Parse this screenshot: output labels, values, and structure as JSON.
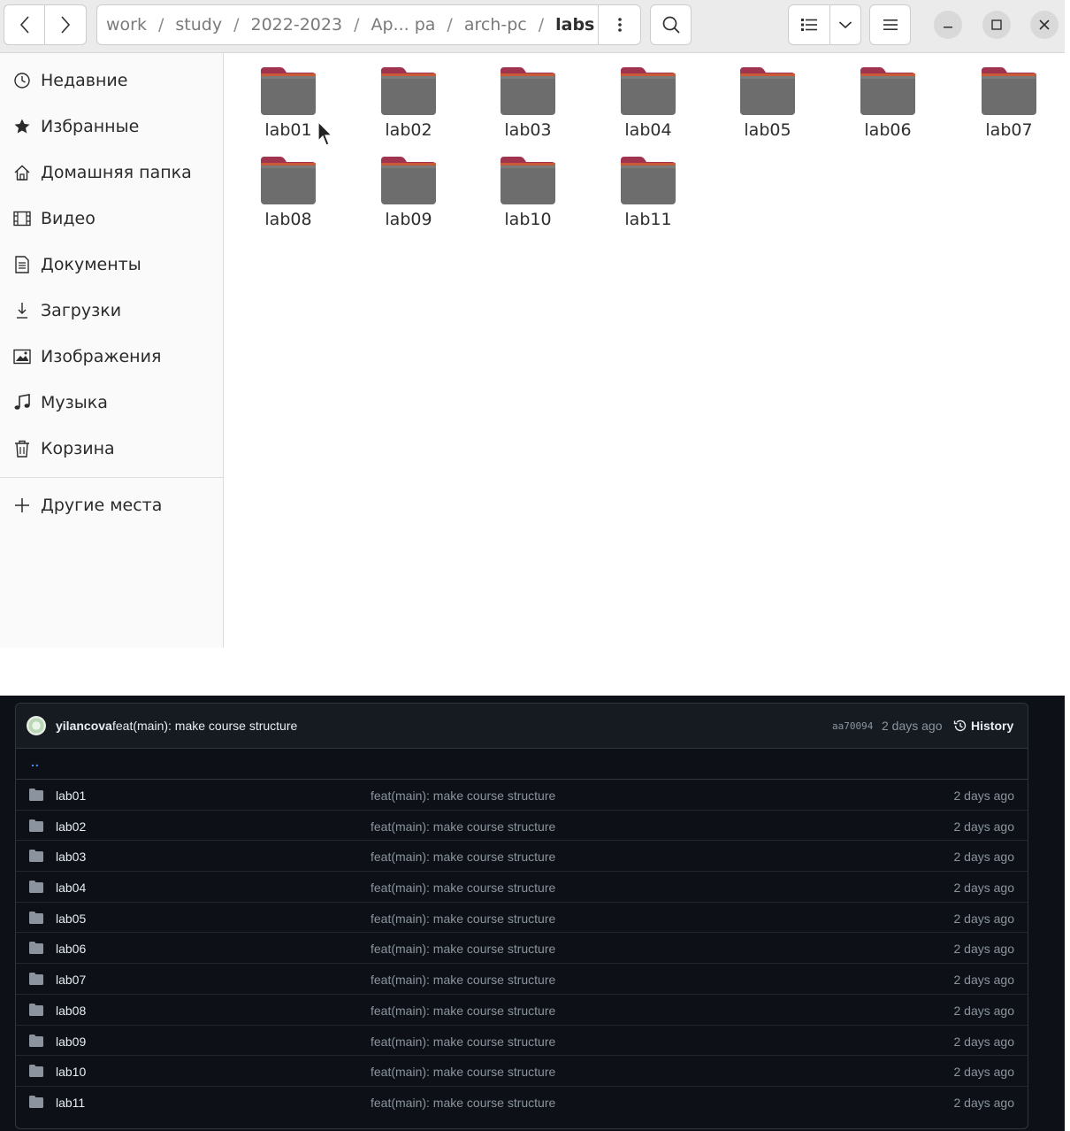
{
  "file_manager": {
    "path": {
      "segments": [
        "work",
        "study",
        "2022-2023",
        "Ар... ра",
        "arch-pc"
      ],
      "current": "labs",
      "separator": "/"
    },
    "sidebar": {
      "items": [
        {
          "label": "Недавние",
          "icon": "clock-icon"
        },
        {
          "label": "Избранные",
          "icon": "star-icon"
        },
        {
          "label": "Домашняя папка",
          "icon": "home-icon"
        },
        {
          "label": "Видео",
          "icon": "film-icon"
        },
        {
          "label": "Документы",
          "icon": "document-icon"
        },
        {
          "label": "Загрузки",
          "icon": "download-icon"
        },
        {
          "label": "Изображения",
          "icon": "image-icon"
        },
        {
          "label": "Музыка",
          "icon": "music-icon"
        },
        {
          "label": "Корзина",
          "icon": "trash-icon"
        }
      ],
      "other_places": "Другие места"
    },
    "folders": [
      "lab01",
      "lab02",
      "lab03",
      "lab04",
      "lab05",
      "lab06",
      "lab07",
      "lab08",
      "lab09",
      "lab10",
      "lab11"
    ]
  },
  "github": {
    "last_commit": {
      "author": "yilancova",
      "message": "feat(main): make course structure",
      "hash": "aa70094",
      "time": "2 days ago"
    },
    "history_label": "History",
    "parent_dir": "..",
    "rows": [
      {
        "name": "lab01",
        "message": "feat(main): make course structure",
        "age": "2 days ago"
      },
      {
        "name": "lab02",
        "message": "feat(main): make course structure",
        "age": "2 days ago"
      },
      {
        "name": "lab03",
        "message": "feat(main): make course structure",
        "age": "2 days ago"
      },
      {
        "name": "lab04",
        "message": "feat(main): make course structure",
        "age": "2 days ago"
      },
      {
        "name": "lab05",
        "message": "feat(main): make course structure",
        "age": "2 days ago"
      },
      {
        "name": "lab06",
        "message": "feat(main): make course structure",
        "age": "2 days ago"
      },
      {
        "name": "lab07",
        "message": "feat(main): make course structure",
        "age": "2 days ago"
      },
      {
        "name": "lab08",
        "message": "feat(main): make course structure",
        "age": "2 days ago"
      },
      {
        "name": "lab09",
        "message": "feat(main): make course structure",
        "age": "2 days ago"
      },
      {
        "name": "lab10",
        "message": "feat(main): make course structure",
        "age": "2 days ago"
      },
      {
        "name": "lab11",
        "message": "feat(main): make course structure",
        "age": "2 days ago"
      }
    ]
  },
  "colors": {
    "folder_body": "#6d6d6d",
    "folder_tab": "#a0344f",
    "github_bg": "#0d1117",
    "github_link": "#4493f8"
  }
}
